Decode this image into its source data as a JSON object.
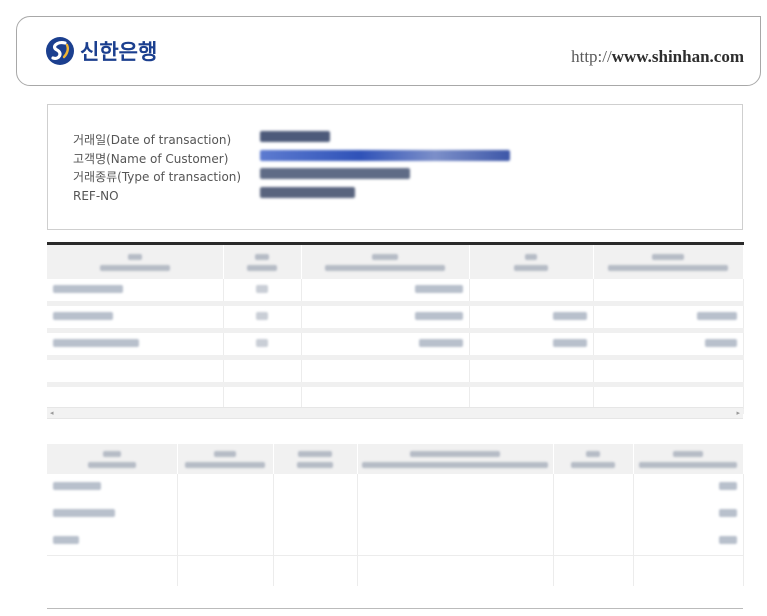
{
  "header": {
    "bank_name": "신한은행",
    "url_prefix": "http://",
    "url_domain": "www.shinhan.com",
    "logo_icon": "shinhan-logo-icon"
  },
  "info": {
    "labels": [
      "거래일(Date of transaction)",
      "고객명(Name of Customer)",
      "거래종류(Type of transaction)",
      "REF-NO"
    ]
  },
  "colors": {
    "brand": "#1b3f8f",
    "header_bg": "#f1f1f1",
    "table_top": "#2a2a2a"
  }
}
